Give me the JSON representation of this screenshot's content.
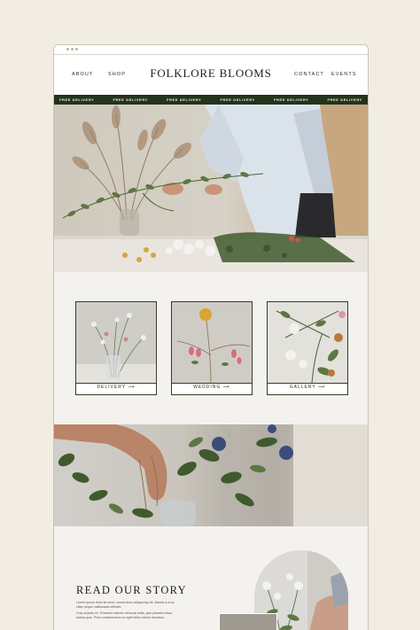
{
  "site": {
    "brand": "FOLKLORE BLOOMS"
  },
  "nav": {
    "about": "ABOUT",
    "shop": "SHOP",
    "contact": "CONTACT",
    "events": "EVENTS"
  },
  "ticker": {
    "items": [
      "FREE DELIVERY",
      "FREE DELIVERY",
      "FREE DELIVERY",
      "FREE DELIVERY",
      "FREE DELIVERY",
      "FREE DELIVERY"
    ]
  },
  "categories": [
    {
      "label": "DELIVERY ⟶"
    },
    {
      "label": "WEDDING ⟶"
    },
    {
      "label": "GALLERY ⟶"
    }
  ],
  "story": {
    "title": "READ OUR STORY",
    "body_line1": "Lorem ipsum dolor sit amet, consectetur adipiscing elit. Mauris a urna vitae neque malesuada ultricies.",
    "body_line2": "Cras at justo mi. Praesent ultrices vehicula nulla, quis pharetra risus lacinia quis. Proin condimentum ex eget tellus rutrum faucibus."
  },
  "colors": {
    "page_bg": "#f1ede3",
    "ticker_bg": "#23331c",
    "ticker_text": "#f2efe6",
    "text_dark": "#1f1d19",
    "section_bg": "#f4f2ee"
  }
}
